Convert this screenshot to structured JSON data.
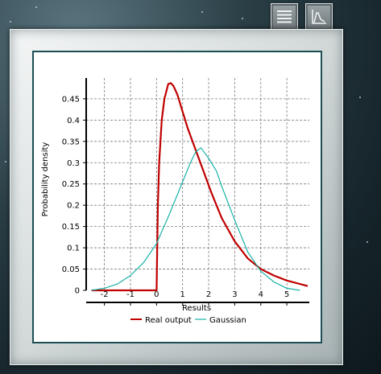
{
  "toolbar": {
    "menu_icon": "hamburger-menu-icon",
    "chart_icon": "chart-icon"
  },
  "colors": {
    "real_output": "#c00000",
    "gaussian": "#1ab2a8",
    "frame_border": "#1c4f54"
  },
  "chart_data": {
    "type": "line",
    "xlabel": "Results",
    "ylabel": "Probability density",
    "xlim": [
      -2.7,
      5.8
    ],
    "ylim": [
      0,
      0.48
    ],
    "x_ticks": [
      "-2",
      "-1",
      "0",
      "1",
      "2",
      "3",
      "4",
      "5"
    ],
    "y_ticks": [
      "0",
      "0.05",
      "0.1",
      "0.15",
      "0.2",
      "0.25",
      "0.3",
      "0.35",
      "0.4",
      "0.45"
    ],
    "grid": true,
    "legend_position": "bottom",
    "series": [
      {
        "name": "Real output",
        "color": "#c00000",
        "x": [
          -2.5,
          0.0,
          0.05,
          0.1,
          0.2,
          0.3,
          0.45,
          0.55,
          0.65,
          0.8,
          1.0,
          1.2,
          1.5,
          1.8,
          2.1,
          2.5,
          3.0,
          3.5,
          4.0,
          4.5,
          5.0,
          5.5,
          5.8
        ],
        "y": [
          0.0,
          0.0,
          0.2,
          0.3,
          0.4,
          0.45,
          0.485,
          0.487,
          0.48,
          0.46,
          0.42,
          0.38,
          0.33,
          0.28,
          0.23,
          0.17,
          0.115,
          0.075,
          0.05,
          0.035,
          0.023,
          0.015,
          0.01
        ]
      },
      {
        "name": "Gaussian",
        "color": "#1ab2a8",
        "x": [
          -2.5,
          -2.0,
          -1.5,
          -1.0,
          -0.5,
          0.0,
          0.5,
          1.0,
          1.3,
          1.5,
          1.7,
          2.0,
          2.3,
          2.5,
          3.0,
          3.5,
          4.0,
          4.5,
          5.0,
          5.5
        ],
        "y": [
          0.0,
          0.005,
          0.015,
          0.035,
          0.065,
          0.11,
          0.18,
          0.255,
          0.3,
          0.325,
          0.335,
          0.31,
          0.28,
          0.245,
          0.165,
          0.09,
          0.045,
          0.02,
          0.005,
          0.0
        ]
      }
    ]
  }
}
